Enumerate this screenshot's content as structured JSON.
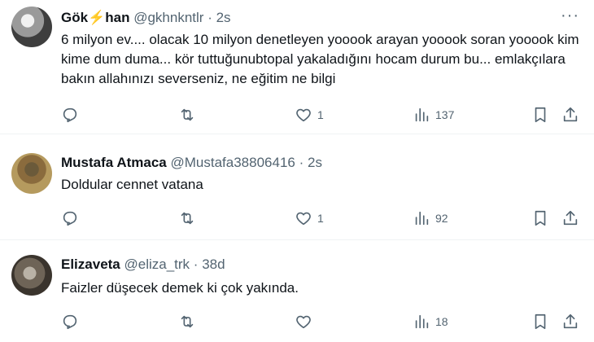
{
  "tweets": [
    {
      "name_pre": "Gök",
      "name_icon": "lightning-emoji",
      "name_post": "han",
      "handle": "@gkhnkntlr",
      "sep": "·",
      "time": "2s",
      "more": "···",
      "text": "6 milyon ev.... olacak 10 milyon denetleyen yooook arayan yooook soran yooook kim kime dum duma... kör tuttuğunubtopal yakaladığını hocam durum bu... emlakçılara bakın allahınızı severseniz, ne eğitim ne bilgi",
      "likes": "1",
      "views": "137"
    },
    {
      "name": "Mustafa Atmaca",
      "handle": "@Mustafa38806416",
      "sep": "·",
      "time": "2s",
      "text": "Doldular cennet vatana",
      "likes": "1",
      "views": "92"
    },
    {
      "name": "Elizaveta",
      "handle": "@eliza_trk",
      "sep": "·",
      "time": "38d",
      "text": "Faizler düşecek demek ki çok yakında.",
      "views": "18"
    }
  ]
}
